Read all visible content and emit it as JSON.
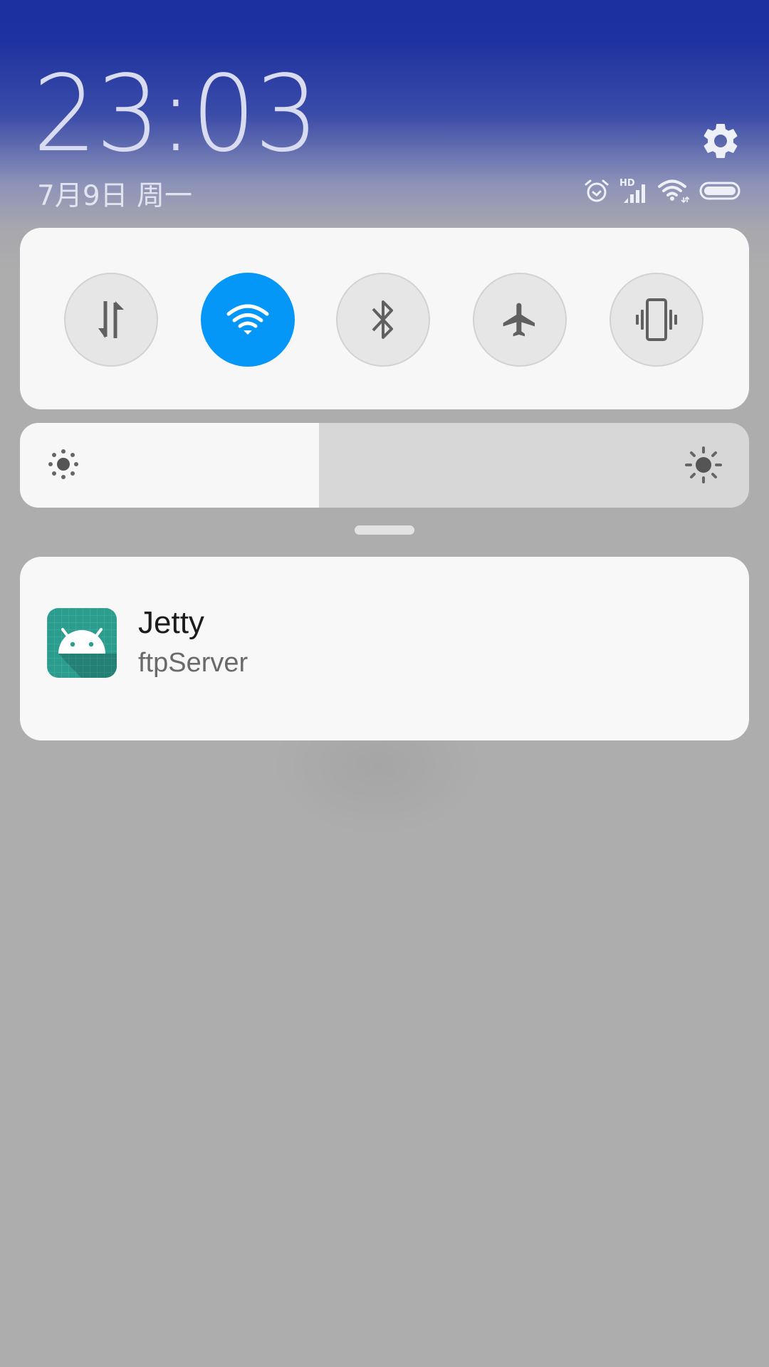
{
  "header": {
    "time": "23:03",
    "date": "7月9日 周一",
    "settings_icon": "gear-icon",
    "status_icons": [
      "alarm-icon",
      "hd-signal-icon",
      "wifi-icon",
      "battery-icon"
    ],
    "signal_label": "HD"
  },
  "quick_settings": {
    "toggles": [
      {
        "name": "mobile-data",
        "icon": "mobile-data-icon",
        "active": false
      },
      {
        "name": "wifi",
        "icon": "wifi-icon",
        "active": true
      },
      {
        "name": "bluetooth",
        "icon": "bluetooth-icon",
        "active": false
      },
      {
        "name": "airplane-mode",
        "icon": "airplane-icon",
        "active": false
      },
      {
        "name": "vibrate",
        "icon": "vibrate-icon",
        "active": false
      }
    ],
    "active_color": "#0597f8"
  },
  "brightness": {
    "level": 0.41,
    "low_icon": "brightness-low-icon",
    "high_icon": "brightness-high-icon"
  },
  "notification": {
    "app_icon": "android-app-icon",
    "title": "Jetty",
    "text": "ftpServer",
    "icon_color": "#2a9d8f"
  }
}
